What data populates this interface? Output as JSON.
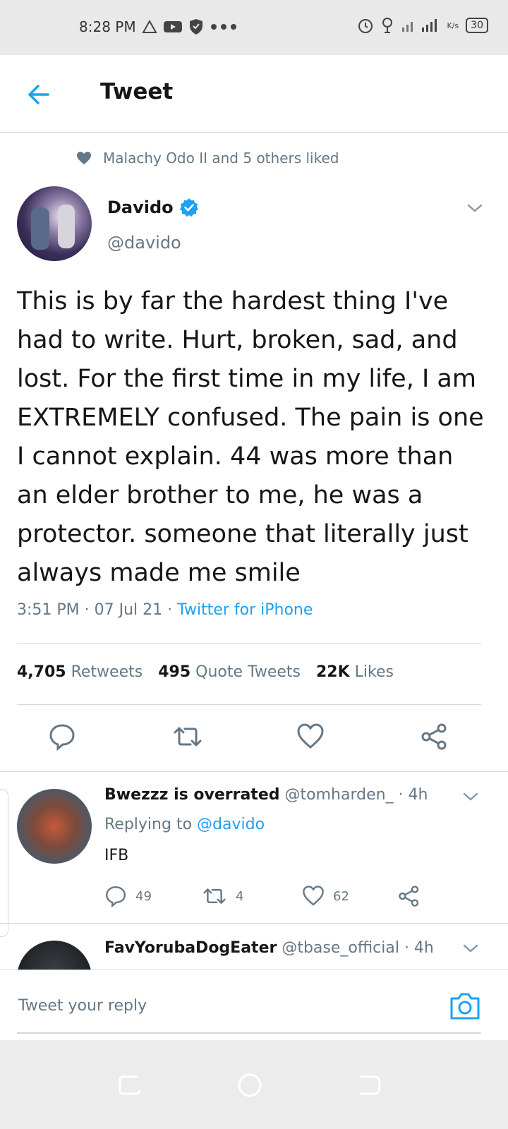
{
  "status_bar": {
    "time": "8:28 PM",
    "battery": "30",
    "icons": [
      "warning-triangle-icon",
      "youtube-icon",
      "shield-icon",
      "more-dots-icon",
      "alarm-icon",
      "location-icon",
      "signal-icon",
      "data-speed-icon"
    ],
    "data_speed_unit": "K/s"
  },
  "header": {
    "title": "Tweet"
  },
  "social_context": {
    "text": "Malachy Odo II and 5 others liked"
  },
  "tweet": {
    "author_name": "Davido",
    "author_handle": "@davido",
    "text": "This is by far the hardest thing I've had to write. Hurt, broken, sad, and lost. For the first time in my life, I am EXTREMELY confused. The pain is one I cannot explain. 44 was more than an elder brother to me, he was a protector. someone that literally just always made me smile",
    "time": "3:51 PM",
    "date": "07 Jul 21",
    "source": "Twitter for iPhone",
    "separator": " · ",
    "stats": {
      "retweets_count": "4,705",
      "retweets_label": "Retweets",
      "quotes_count": "495",
      "quotes_label": "Quote Tweets",
      "likes_count": "22K",
      "likes_label": "Likes"
    }
  },
  "replies": [
    {
      "name": "Bwezzz is overrated",
      "handle": "@tomharden_",
      "age": " · 4h",
      "replying_prefix": "Replying to ",
      "replying_to": "@davido",
      "text": "IFB",
      "reply_count": "49",
      "retweet_count": "4",
      "like_count": "62"
    },
    {
      "name": "FavYorubaDogEater",
      "handle": "@tbase_official",
      "age": " · 4h"
    }
  ],
  "composer": {
    "placeholder": "Tweet your reply"
  },
  "colors": {
    "accent": "#1da1f2",
    "text_primary": "#14171a",
    "text_secondary": "#657786",
    "divider": "#cfd9de"
  }
}
